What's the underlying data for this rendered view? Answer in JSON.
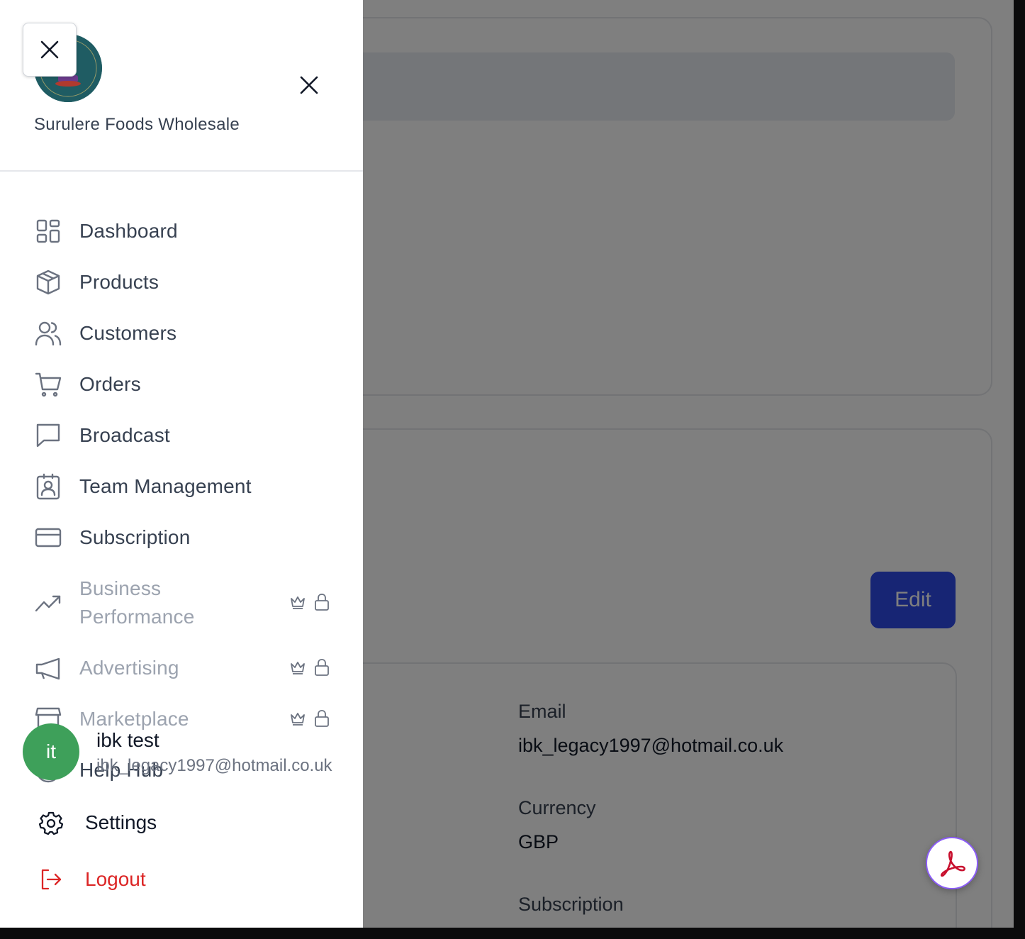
{
  "brand": {
    "name": "Surulere Foods Wholesale",
    "logo_text": "SURULERE FOODS"
  },
  "nav": {
    "items": [
      {
        "label": "Dashboard",
        "icon": "dashboard-grid-icon"
      },
      {
        "label": "Products",
        "icon": "box-icon"
      },
      {
        "label": "Customers",
        "icon": "users-icon"
      },
      {
        "label": "Orders",
        "icon": "cart-icon"
      },
      {
        "label": "Broadcast",
        "icon": "message-icon"
      },
      {
        "label": "Team Management",
        "icon": "id-badge-icon"
      },
      {
        "label": "Subscription",
        "icon": "credit-card-icon"
      }
    ],
    "locked_items": [
      {
        "label_line1": "Business",
        "label_line2": "Performance",
        "icon": "trending-up-icon"
      },
      {
        "label": "Advertising",
        "icon": "megaphone-icon"
      },
      {
        "label": "Marketplace",
        "icon": "store-icon"
      }
    ],
    "help_label": "Help Hub"
  },
  "user": {
    "initials": "it",
    "name": "ibk test",
    "email": "ibk_legacy1997@hotmail.co.uk"
  },
  "bottom": {
    "settings_label": "Settings",
    "logout_label": "Logout"
  },
  "main": {
    "edit_label": "Edit",
    "fields": [
      {
        "label": "Email",
        "value": "ibk_legacy1997@hotmail.co.uk"
      },
      {
        "label": "Currency",
        "value": "GBP"
      },
      {
        "label": "Subscription",
        "value": ""
      }
    ]
  },
  "colors": {
    "accent": "#2f4ae8",
    "avatar": "#3ea05a",
    "logout": "#dc2626"
  }
}
